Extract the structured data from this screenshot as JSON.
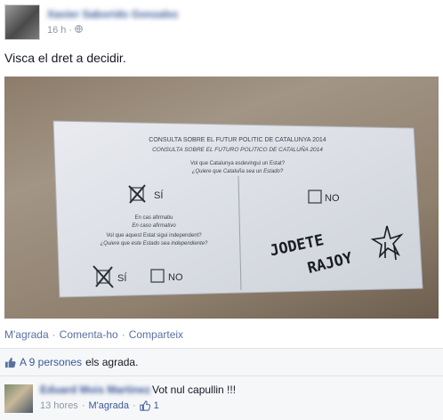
{
  "post": {
    "author": "Xavier Saborido Gonzalez",
    "time": "16 h",
    "privacy_icon": "globe-icon",
    "text": "Visca el dret a decidir."
  },
  "ballot": {
    "title_ca": "CONSULTA SOBRE EL FUTUR POLITIC DE CATALUNYA 2014",
    "title_es": "CONSULTA SOBRE EL FUTURO POLITICO DE CATALUÑA 2014",
    "q1_ca": "Vol que Catalunya esdevingui un Estat?",
    "q1_es": "¿Quiere que Cataluña sea un Estado?",
    "q1_yes": "SÍ",
    "q1_no": "NO",
    "cond_ca": "En cas afirmatiu",
    "cond_es": "En caso afirmativo",
    "q2_ca": "Vol que aquest Estat sigui independent?",
    "q2_es": "¿Quiere que este Estado sea independiente?",
    "q2_yes": "SÍ",
    "q2_no": "NO",
    "handwriting_1": "JODETE",
    "handwriting_2": "RAJOY"
  },
  "actions": {
    "like": "M'agrada",
    "comment": "Comenta-ho",
    "share": "Comparteix",
    "separator": "·"
  },
  "likes": {
    "prefix": "A",
    "count_link": "A 9 persones",
    "suffix": "els agrada."
  },
  "comment": {
    "author": "Eduard Mois Martinez",
    "text": "Vot nul capullin !!!",
    "time": "13 hores",
    "like": "M'agrada",
    "separator": "·",
    "like_count": "1"
  },
  "colors": {
    "link": "#3b5998",
    "meta": "#9197a3",
    "bar_bg": "#f6f7f9"
  }
}
